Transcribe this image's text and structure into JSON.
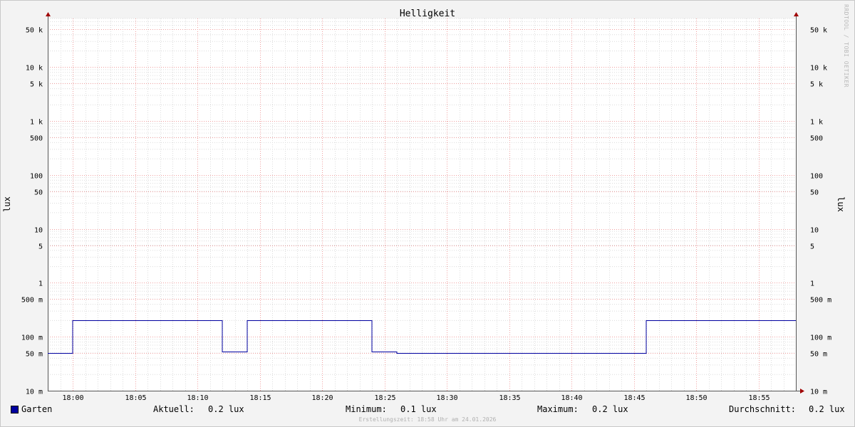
{
  "window": {
    "watermark": "RRDTOOL / TOBI OETIKER"
  },
  "chart_data": {
    "type": "line",
    "title": "Helligkeit",
    "ylabel": "lux",
    "yscale": "log",
    "ylim": [
      0.01,
      80000
    ],
    "xlim": [
      "17:58",
      "18:58"
    ],
    "x_ticks": [
      "18:00",
      "18:05",
      "18:10",
      "18:15",
      "18:20",
      "18:25",
      "18:30",
      "18:35",
      "18:40",
      "18:45",
      "18:50",
      "18:55"
    ],
    "y_ticks": [
      {
        "value": 50000,
        "label": "50 k"
      },
      {
        "value": 10000,
        "label": "10 k"
      },
      {
        "value": 5000,
        "label": "5 k"
      },
      {
        "value": 1000,
        "label": "1 k"
      },
      {
        "value": 500,
        "label": "500"
      },
      {
        "value": 100,
        "label": "100"
      },
      {
        "value": 50,
        "label": "50"
      },
      {
        "value": 10,
        "label": "10"
      },
      {
        "value": 5,
        "label": "5"
      },
      {
        "value": 1,
        "label": "1"
      },
      {
        "value": 0.5,
        "label": "500 m"
      },
      {
        "value": 0.1,
        "label": "100 m"
      },
      {
        "value": 0.05,
        "label": "50 m"
      },
      {
        "value": 0.01,
        "label": "10 m"
      }
    ],
    "grid": true,
    "series": [
      {
        "name": "Garten",
        "color": "#0000a0",
        "step": true,
        "x": [
          "17:58",
          "18:00",
          "18:12",
          "18:14",
          "18:24",
          "18:26",
          "18:46",
          "18:58"
        ],
        "values": [
          0.05,
          0.2,
          0.053,
          0.2,
          0.053,
          0.05,
          0.2,
          0.2
        ]
      }
    ]
  },
  "legend": {
    "series_name": "Garten",
    "current_label": "Aktuell:",
    "current_value": "0.2 lux",
    "min_label": "Minimum:",
    "min_value": "0.1 lux",
    "max_label": "Maximum:",
    "max_value": "0.2 lux",
    "avg_label": "Durchschnitt:",
    "avg_value": "0.2 lux"
  },
  "footer": "Erstellungszeit: 18:58 Uhr am 24.01.2026"
}
